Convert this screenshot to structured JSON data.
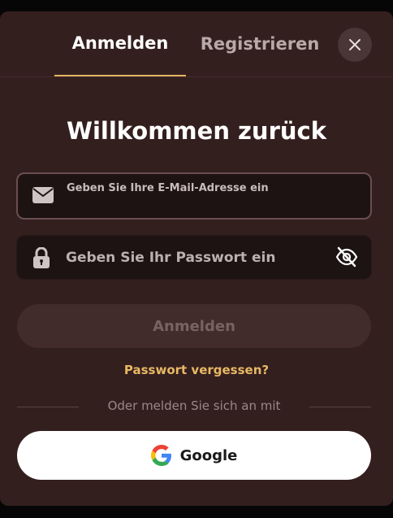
{
  "tabs": {
    "login_label": "Anmelden",
    "register_label": "Registrieren",
    "active": "login"
  },
  "close": {
    "icon": "close-icon"
  },
  "heading": "Willkommen zurück",
  "email": {
    "icon": "envelope-icon",
    "placeholder": "Geben Sie Ihre E-Mail-Adresse ein",
    "value": ""
  },
  "password": {
    "icon": "lock-icon",
    "placeholder": "Geben Sie Ihr Passwort ein",
    "value": "",
    "toggle_icon": "eye-slash-icon"
  },
  "login_button": "Anmelden",
  "forgot_password": "Passwort vergessen?",
  "divider_text": "Oder melden Sie sich an mit",
  "google_button": "Google",
  "colors": {
    "background": "#341f1f",
    "accent": "#e3b563",
    "field_bg": "#1e1313",
    "button_disabled": "#412b2b"
  }
}
